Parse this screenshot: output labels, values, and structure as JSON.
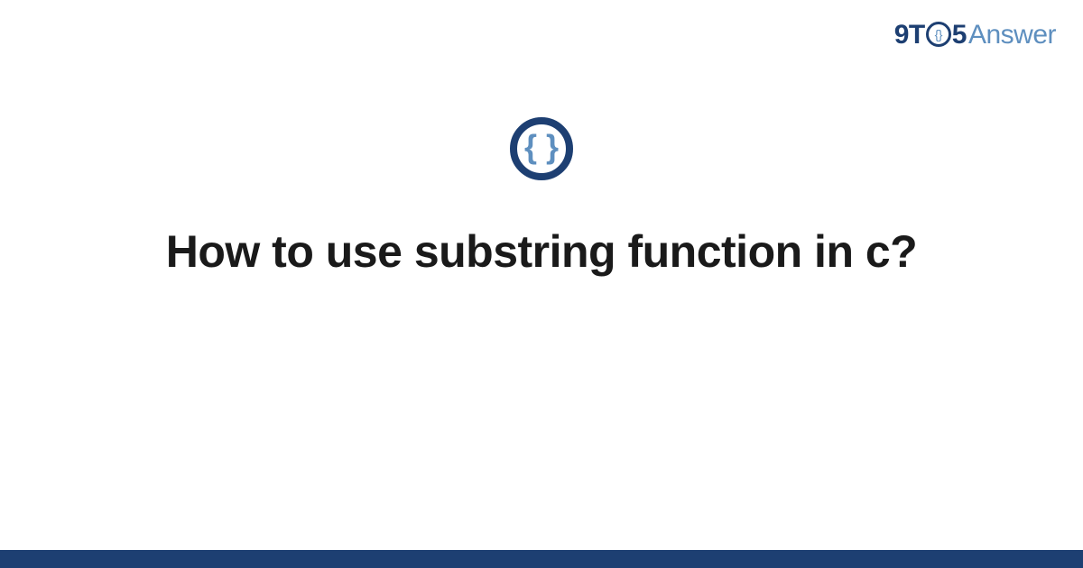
{
  "logo": {
    "part1": "9T",
    "circleGlyph": "{}",
    "part2": "5",
    "part3": "Answer"
  },
  "icon": {
    "glyph": "{ }",
    "name": "code-braces-icon"
  },
  "title": "How to use substring function in c?",
  "colors": {
    "primary": "#1d3f72",
    "secondary": "#5e8fbf"
  }
}
